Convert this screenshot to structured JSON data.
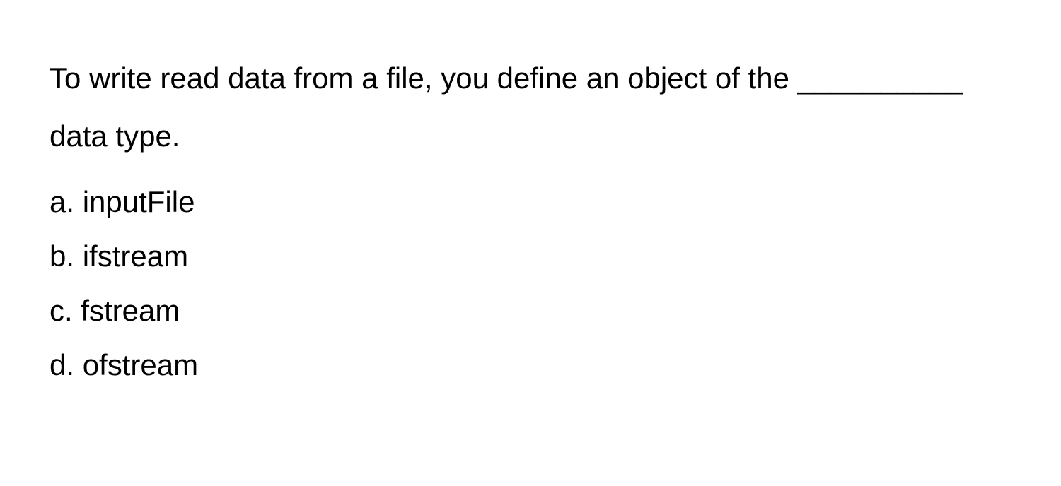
{
  "question": {
    "text": "To write read data from a file, you define an object of the __________ data type."
  },
  "options": [
    {
      "label": "a.",
      "text": "inputFile"
    },
    {
      "label": "b.",
      "text": "ifstream"
    },
    {
      "label": "c.",
      "text": "fstream"
    },
    {
      "label": "d.",
      "text": "ofstream"
    }
  ]
}
